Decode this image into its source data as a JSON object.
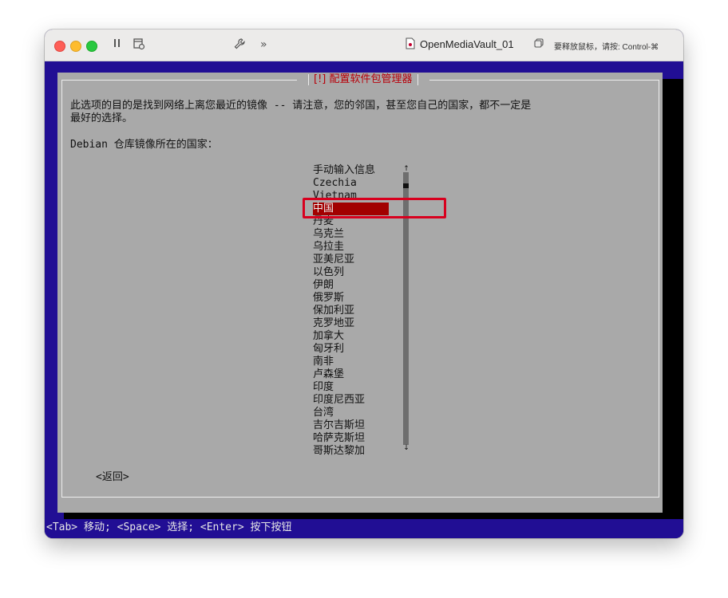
{
  "window": {
    "title": "OpenMediaVault_01",
    "release_hint": "要释放鼠标，请按: Control-⌘"
  },
  "dialog": {
    "title": "[!] 配置软件包管理器",
    "description_line1": "此选项的目的是找到网络上离您最近的镜像 -- 请注意，您的邻国，甚至您自己的国家，都不一定是",
    "description_line2": "最好的选择。",
    "prompt": "Debian 仓库镜像所在的国家：",
    "countries": [
      "手动输入信息",
      "Czechia",
      "Vietnam",
      "中国",
      "丹麦",
      "乌克兰",
      "乌拉圭",
      "亚美尼亚",
      "以色列",
      "伊朗",
      "俄罗斯",
      "保加利亚",
      "克罗地亚",
      "加拿大",
      "匈牙利",
      "南非",
      "卢森堡",
      "印度",
      "印度尼西亚",
      "台湾",
      "吉尔吉斯坦",
      "哈萨克斯坦",
      "哥斯达黎加"
    ],
    "selected": "中国",
    "back_button": "<返回>",
    "scroll_up": "↑",
    "scroll_down": "↓"
  },
  "status_bar": "<Tab> 移动; <Space> 选择; <Enter> 按下按钮",
  "colors": {
    "background": "#210e94",
    "dialog": "#a9a9a9",
    "title_text": "#b8000a",
    "selection": "#a20000",
    "annotation": "#d8001e"
  }
}
